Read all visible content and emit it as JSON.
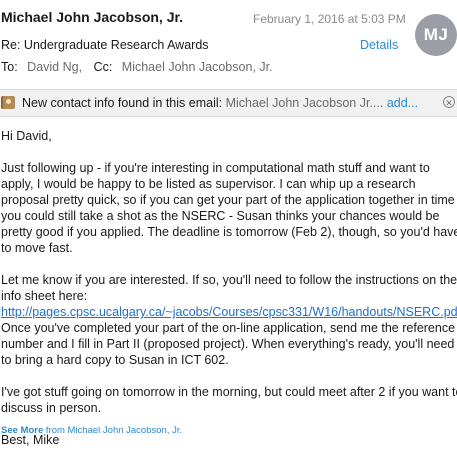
{
  "header": {
    "from": "Michael John Jacobson, Jr.",
    "date": "February 1, 2016 at 5:03 PM",
    "avatar_initials": "MJ",
    "subject": "Re: Undergraduate Research Awards",
    "details_label": "Details",
    "to_label": "To:",
    "to": "David Ng,",
    "cc_label": "Cc:",
    "cc": "Michael John Jacobson, Jr."
  },
  "banner": {
    "text": "New contact info found in this email:",
    "contact": "Michael John Jacobson Jr....",
    "add_label": "add...",
    "icon": "contact-card-icon"
  },
  "body": {
    "greeting": "Hi David,",
    "p1": [
      "Just following up - if you're interesting in computational math stuff and want to",
      "apply, I would be happy to be listed as supervisor.  I can whip up a research",
      "proposal pretty quick, so if you can get your part of the application together in time",
      "you could still take a shot as the NSERC - Susan thinks your chances would be",
      "pretty good if you applied. The deadline is tomorrow (Feb 2), though, so you'd have",
      "to move fast."
    ],
    "p2_before": [
      "Let me know if you are interested.  If so, you'll need to follow the instructions on the",
      "info sheet here:"
    ],
    "link": "http://pages.cpsc.ucalgary.ca/~jacobs/Courses/cpsc331/W16/handouts/NSERC.pdf",
    "p2_after": [
      "Once you've completed your part of the on-line application, send me the reference",
      "number and I fill in Part II (proposed project).  When everything's ready, you'll need",
      "to bring a hard copy to Susan in ICT 602."
    ],
    "p3": [
      "I've got stuff going on tomorrow in the morning, but could meet after 2 if you want to",
      "discuss in person."
    ],
    "signoff": "Best, Mike"
  },
  "footer": {
    "see_more": "See More",
    "from_text": "from Michael John Jacobson, Jr."
  }
}
